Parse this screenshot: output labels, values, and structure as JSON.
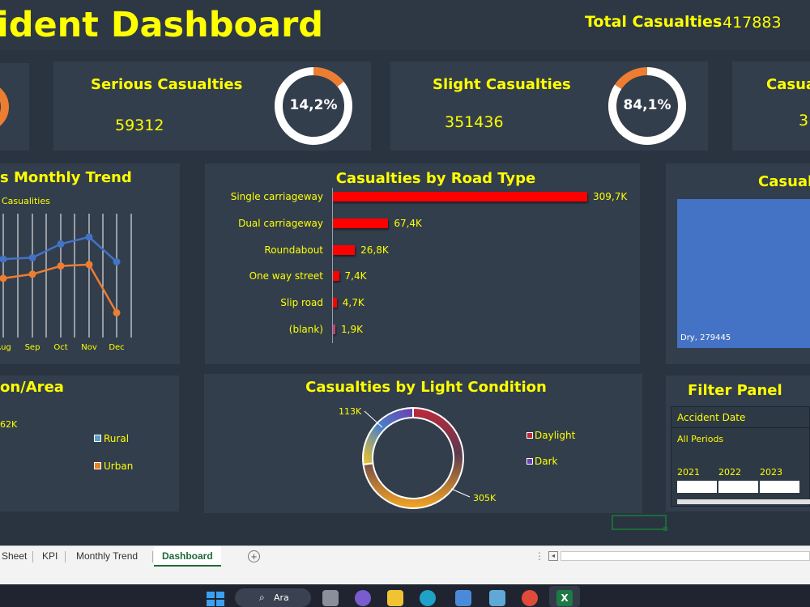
{
  "header": {
    "title": "ident Dashboard",
    "total_label": "Total Casualties",
    "total_value": "417883"
  },
  "kpis": {
    "serious": {
      "label": "Serious Casualties",
      "value": "59312",
      "percent_label": "14,2%",
      "percent": 14.2
    },
    "slight": {
      "label": "Slight Casualties",
      "value": "351436",
      "percent_label": "84,1%",
      "percent": 84.1
    },
    "partial": {
      "label": "Casua",
      "value": "3"
    }
  },
  "monthly_trend": {
    "title": "s Monthly Trend",
    "legend": "Casualities",
    "months": [
      "Aug",
      "Sep",
      "Oct",
      "Nov",
      "Dec"
    ]
  },
  "light_condition": {
    "title": "Casualties by Light Condition",
    "legend": [
      {
        "label": "Daylight",
        "color": "#c0283a"
      },
      {
        "label": "Dark",
        "color": "#6a3fb0"
      }
    ],
    "labels": {
      "dark": "113K",
      "daylight": "305K"
    }
  },
  "surface": {
    "title": "Casualt",
    "bar_label": "Dry, 279445"
  },
  "area": {
    "title": "on/Area",
    "value_label": "62K",
    "legend": [
      {
        "label": "Rural",
        "color": "#5aa0c8"
      },
      {
        "label": "Urban",
        "color": "#e8801e"
      }
    ]
  },
  "filter": {
    "title": "Filter Panel",
    "slicer_header": "Accident Date",
    "period": "All Periods",
    "years": [
      "2021",
      "2022",
      "2023"
    ]
  },
  "tabs": {
    "sheet": "Sheet",
    "kpi": "KPI",
    "monthly": "Monthly Trend",
    "dashboard": "Dashboard",
    "add": "+"
  },
  "taskbar": {
    "search": "Ara"
  },
  "colors": {
    "background": "#2a3441",
    "card": "#323e4c",
    "accent": "#ffff00",
    "orange": "#ed7d31",
    "blue": "#4472c4",
    "red": "#ff0000"
  },
  "chart_data": [
    {
      "type": "bar",
      "title": "Casualties by Road Type",
      "categories": [
        "Single carriageway",
        "Dual carriageway",
        "Roundabout",
        "One way street",
        "Slip road",
        "(blank)"
      ],
      "values": [
        309700,
        67400,
        26800,
        7400,
        4700,
        1900
      ],
      "value_labels": [
        "309,7K",
        "67,4K",
        "26,8K",
        "7,4K",
        "4,7K",
        "1,9K"
      ],
      "orientation": "horizontal"
    },
    {
      "type": "line",
      "title": "s Monthly Trend",
      "x": [
        "Aug",
        "Sep",
        "Oct",
        "Nov",
        "Dec"
      ],
      "series": [
        {
          "values": [
            36700,
            36800,
            37800,
            38300,
            36500
          ]
        },
        {
          "values": [
            35300,
            35600,
            36200,
            36300,
            32800
          ]
        }
      ]
    },
    {
      "type": "pie",
      "title": "Casualties by Light Condition",
      "categories": [
        "Daylight",
        "Dark"
      ],
      "values": [
        305000,
        113000
      ]
    }
  ]
}
